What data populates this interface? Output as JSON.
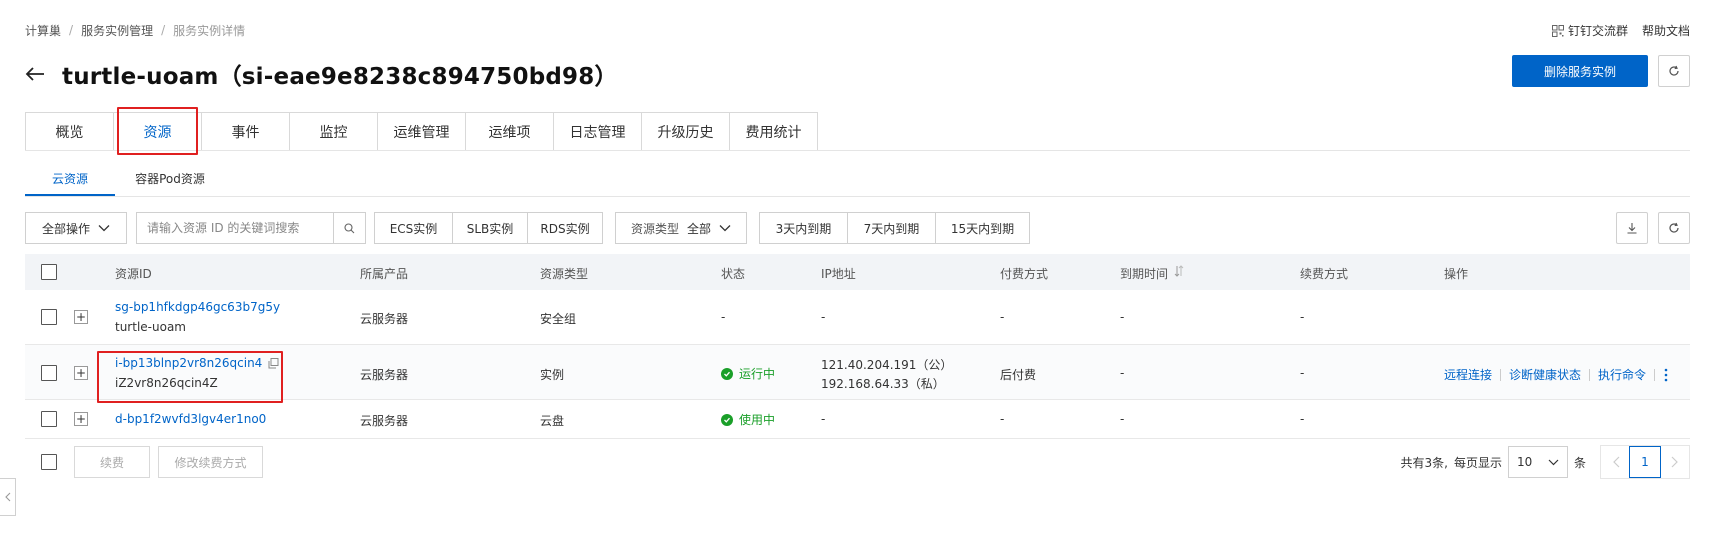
{
  "breadcrumb": {
    "items": [
      "计算巢",
      "服务实例管理",
      "服务实例详情"
    ],
    "separator": "/"
  },
  "top_links": {
    "dingtalk_group": "钉钉交流群",
    "help_doc": "帮助文档"
  },
  "header": {
    "title": "turtle-uoam（si-eae9e8238c894750bd98）",
    "delete_button": "删除服务实例",
    "accent_color": "#0064c8"
  },
  "main_tabs": {
    "items": [
      "概览",
      "资源",
      "事件",
      "监控",
      "运维管理",
      "运维项",
      "日志管理",
      "升级历史",
      "费用统计"
    ],
    "active": "资源"
  },
  "sub_tabs": {
    "items": [
      "云资源",
      "容器Pod资源"
    ],
    "active": "云资源"
  },
  "toolbar": {
    "all_actions": "全部操作",
    "search_placeholder": "请输入资源 ID 的关键词搜索",
    "filter_ecs": "ECS实例",
    "filter_slb": "SLB实例",
    "filter_rds": "RDS实例",
    "resource_type_label": "资源类型",
    "resource_type_value": "全部",
    "expire_3": "3天内到期",
    "expire_7": "7天内到期",
    "expire_15": "15天内到期"
  },
  "table": {
    "headers": {
      "resource_id": "资源ID",
      "product": "所属产品",
      "type": "资源类型",
      "status": "状态",
      "ip": "IP地址",
      "billing": "付费方式",
      "expire": "到期时间",
      "renew": "续费方式",
      "ops": "操作"
    },
    "rows": [
      {
        "id": "sg-bp1hfkdgp46gc63b7g5y",
        "name": "turtle-uoam",
        "product": "云服务器",
        "type": "安全组",
        "status": "-",
        "ip": "-",
        "billing": "-",
        "expire": "-",
        "renew": "-"
      },
      {
        "id": "i-bp13blnp2vr8n26qcin4",
        "name": "iZ2vr8n26qcin4Z",
        "product": "云服务器",
        "type": "实例",
        "status": "运行中",
        "ip_public": "121.40.204.191（公）",
        "ip_private": "192.168.64.33（私）",
        "billing": "后付费",
        "expire": "-",
        "renew": "-",
        "ops": [
          "远程连接",
          "诊断健康状态",
          "执行命令"
        ]
      },
      {
        "id": "d-bp1f2wvfd3lgv4er1no0",
        "product": "云服务器",
        "type": "云盘",
        "status": "使用中",
        "ip": "-",
        "billing": "-",
        "expire": "-",
        "renew": "-"
      }
    ]
  },
  "footer": {
    "renew_button": "续费",
    "modify_renew_button": "修改续费方式",
    "total": "共有3条,",
    "per_page_label": "每页显示",
    "per_page_value": "10",
    "per_page_unit": "条",
    "current_page": "1"
  }
}
